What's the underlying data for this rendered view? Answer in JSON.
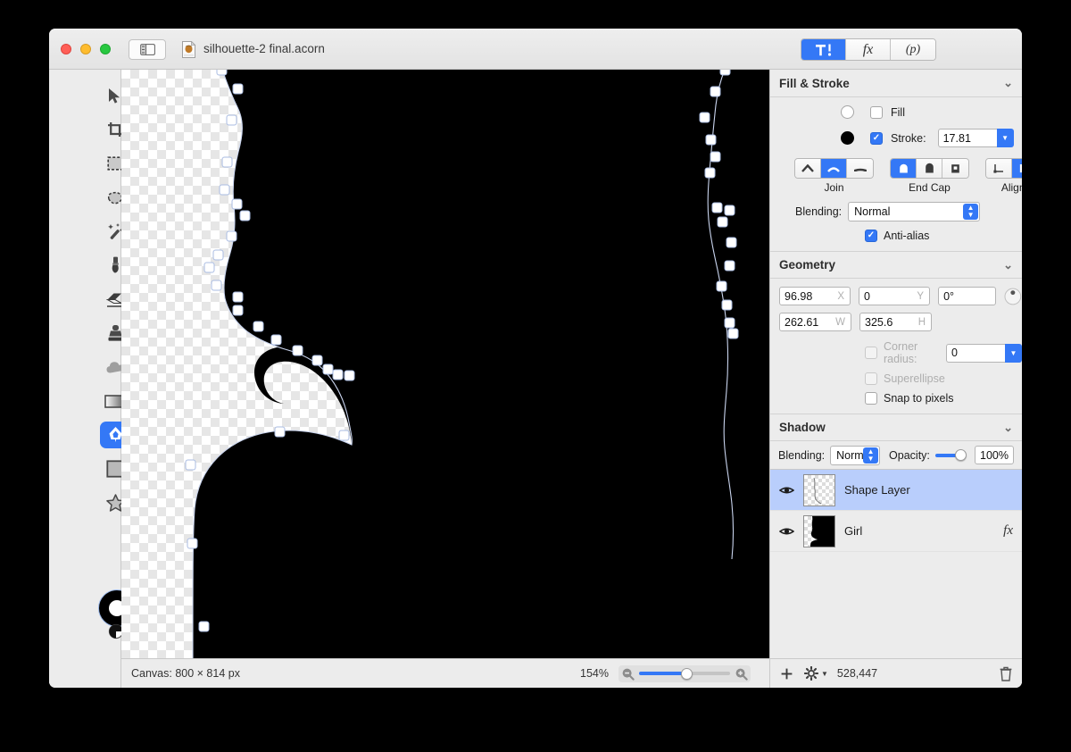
{
  "window": {
    "title": "silhouette-2 final.acorn",
    "traffic_lights": [
      "close",
      "minimize",
      "zoom"
    ],
    "sidebar_toggle_icon": "sidebar-toggle-icon",
    "document_icon": "acorn-document-icon"
  },
  "mode_segments": [
    {
      "name": "tools-inspector",
      "glyph": "⇞",
      "active": true
    },
    {
      "name": "filters",
      "glyph": "fx",
      "active": false
    },
    {
      "name": "presets",
      "glyph": "(p)",
      "active": false
    }
  ],
  "tools": [
    {
      "name": "move-tool",
      "icon": "arrow-cursor-icon",
      "active": false
    },
    {
      "name": "zoom-tool",
      "icon": "magnifier-plus-icon",
      "active": false
    },
    {
      "name": "crop-tool",
      "icon": "crop-icon",
      "active": false,
      "has_submenu": true
    },
    {
      "name": "transform-tool",
      "icon": "move-arrows-icon",
      "active": false
    },
    {
      "name": "rectangle-select-tool",
      "icon": "dashed-rectangle-icon",
      "active": false
    },
    {
      "name": "ellipse-select-tool",
      "icon": "dashed-ellipse-icon",
      "active": false
    },
    {
      "name": "lasso-tool",
      "icon": "lasso-icon",
      "active": false
    },
    {
      "name": "polygon-lasso-tool",
      "icon": "polygon-lasso-icon",
      "active": false
    },
    {
      "name": "magic-wand-tool",
      "icon": "magic-wand-icon",
      "active": false
    },
    {
      "name": "instant-alpha-tool",
      "icon": "dotted-wand-icon",
      "active": false
    },
    {
      "name": "brush-tool",
      "icon": "paintbrush-icon",
      "active": false
    },
    {
      "name": "pencil-tool",
      "icon": "pencil-icon",
      "active": false
    },
    {
      "name": "eraser-tool",
      "icon": "eraser-icon",
      "active": false
    },
    {
      "name": "gradient-tool",
      "icon": "gradient-bar-icon",
      "active": false
    },
    {
      "name": "clone-stamp-tool",
      "icon": "stamp-icon",
      "active": false
    },
    {
      "name": "smudge-tool",
      "icon": "splatter-icon",
      "active": false
    },
    {
      "name": "blur-tool",
      "icon": "cloud-icon",
      "active": false
    },
    {
      "name": "dodge-tool",
      "icon": "sun-icon",
      "active": false
    },
    {
      "name": "gradient-fill-tool",
      "icon": "gradient-rect-icon",
      "active": false
    },
    {
      "name": "text-tool",
      "icon": "text-t-icon",
      "active": false,
      "has_submenu": true
    },
    {
      "name": "bezier-pen-tool",
      "icon": "pen-nib-icon",
      "active": true,
      "has_submenu": true
    },
    {
      "name": "line-tool",
      "icon": "line-icon",
      "active": false
    },
    {
      "name": "rectangle-shape-tool",
      "icon": "rectangle-icon",
      "active": false
    },
    {
      "name": "ellipse-shape-tool",
      "icon": "circle-icon",
      "active": false
    },
    {
      "name": "star-shape-tool",
      "icon": "star-icon",
      "active": false
    },
    {
      "name": "arrow-shape-tool",
      "icon": "arrow-up-icon",
      "active": false
    }
  ],
  "color_swatch": {
    "name": "stroke-fill-swatch",
    "stroke_color": "#000000",
    "fill_color": "#ffffff",
    "mini_controls": [
      "swap-colors-icon",
      "default-colors-icon",
      "color-picker-icon"
    ]
  },
  "canvas": {
    "zoom_label": "154%",
    "size_label": "Canvas: 800 × 814 px",
    "transparency": "checkerboard",
    "shape_color": "#000000"
  },
  "status_bar": {
    "zoom_out_icon": "zoom-out-icon",
    "zoom_in_icon": "zoom-in-icon"
  },
  "fill_stroke": {
    "title": "Fill & Stroke",
    "collapse_icon": "chevron-down-icon",
    "fill": {
      "label": "Fill",
      "checked": false,
      "color": "#ffffff"
    },
    "stroke": {
      "label": "Stroke:",
      "checked": true,
      "color": "#000000",
      "value": "17.81"
    },
    "join": {
      "label": "Join",
      "options": [
        "miter-join-icon",
        "round-join-icon",
        "bevel-join-icon"
      ],
      "selected": 1
    },
    "end_cap": {
      "label": "End Cap",
      "options": [
        "round-cap-icon",
        "square-cap-icon",
        "butt-cap-icon"
      ],
      "selected": 0
    },
    "alignment": {
      "label": "Alignment",
      "options": [
        "align-inside-icon",
        "align-center-icon",
        "align-outside-icon"
      ],
      "selected": 1
    },
    "blending": {
      "label": "Blending:",
      "value": "Normal"
    },
    "antialias": {
      "label": "Anti-alias",
      "checked": true
    }
  },
  "geometry": {
    "title": "Geometry",
    "collapse_icon": "chevron-down-icon",
    "x": {
      "value": "96.98",
      "unit": "X"
    },
    "y": {
      "value": "0",
      "unit": "Y"
    },
    "rotation": {
      "value": "0°"
    },
    "rotation_knob": "rotation-knob-icon",
    "w": {
      "value": "262.61",
      "unit": "W"
    },
    "h": {
      "value": "325.6",
      "unit": "H"
    },
    "corner_radius": {
      "label": "Corner radius:",
      "value": "0",
      "checked": false,
      "disabled": true
    },
    "superellipse": {
      "label": "Superellipse",
      "checked": false,
      "disabled": true
    },
    "snap_to_pixels": {
      "label": "Snap to pixels",
      "checked": false,
      "disabled": false
    }
  },
  "shadow": {
    "title": "Shadow",
    "collapse_icon": "chevron-down-icon",
    "blending": {
      "label": "Blending:",
      "value": "Normal"
    },
    "opacity": {
      "label": "Opacity:",
      "value": "100%",
      "percent": 100
    }
  },
  "layers": [
    {
      "name": "Shape Layer",
      "visible": true,
      "selected": true,
      "has_fx": false,
      "thumb": "shape-path-thumb"
    },
    {
      "name": "Girl",
      "visible": true,
      "selected": false,
      "has_fx": true,
      "fx_label": "fx",
      "thumb": "silhouette-thumb"
    }
  ],
  "layer_bar": {
    "add_icon": "plus-icon",
    "settings_icon": "gear-icon",
    "memory": "528,447",
    "delete_icon": "trash-icon"
  }
}
